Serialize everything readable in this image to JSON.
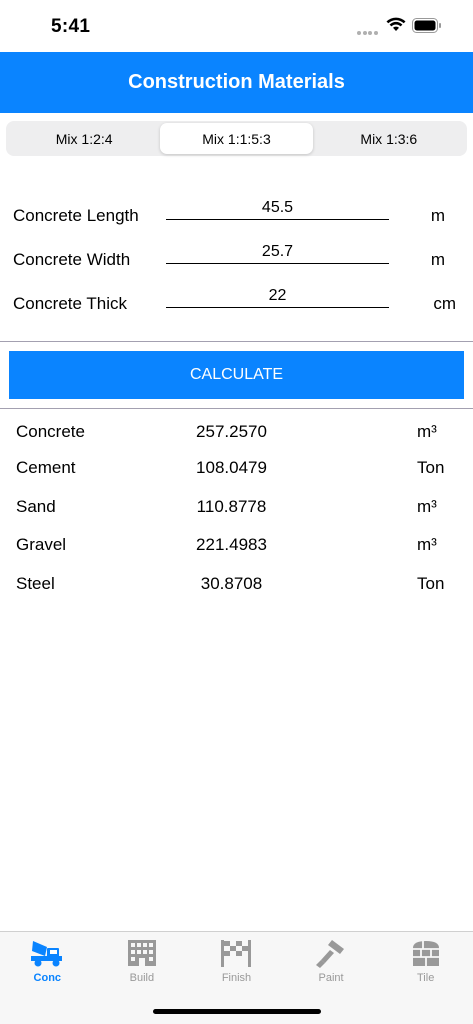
{
  "status_bar": {
    "time": "5:41"
  },
  "nav": {
    "title": "Construction Materials"
  },
  "mix_tabs": [
    {
      "label": "Mix 1:2:4",
      "selected": false
    },
    {
      "label": "Mix 1:1:5:3",
      "selected": true
    },
    {
      "label": "Mix 1:3:6",
      "selected": false
    }
  ],
  "inputs": [
    {
      "label": "Concrete Length",
      "value": "45.5",
      "unit": "m"
    },
    {
      "label": "Concrete Width",
      "value": "25.7",
      "unit": "m"
    },
    {
      "label": "Concrete Thick",
      "value": "22",
      "unit": "cm"
    }
  ],
  "calculate_label": "CALCULATE",
  "results": [
    {
      "name": "Concrete",
      "value": "257.2570",
      "unit": "m³"
    },
    {
      "name": "Cement",
      "value": "108.0479",
      "unit": "Ton"
    },
    {
      "name": "Sand",
      "value": "110.8778",
      "unit": "m³"
    },
    {
      "name": "Gravel",
      "value": "221.4983",
      "unit": "m³"
    },
    {
      "name": "Steel",
      "value": "30.8708",
      "unit": "Ton"
    }
  ],
  "tab_bar": [
    {
      "label": "Conc",
      "icon": "concrete-mixer-icon",
      "active": true
    },
    {
      "label": "Build",
      "icon": "building-icon",
      "active": false
    },
    {
      "label": "Finish",
      "icon": "finish-flag-icon",
      "active": false
    },
    {
      "label": "Paint",
      "icon": "paint-roller-icon",
      "active": false
    },
    {
      "label": "Tile",
      "icon": "tile-icon",
      "active": false
    }
  ],
  "colors": {
    "accent": "#0a84ff",
    "inactive": "#999999"
  }
}
